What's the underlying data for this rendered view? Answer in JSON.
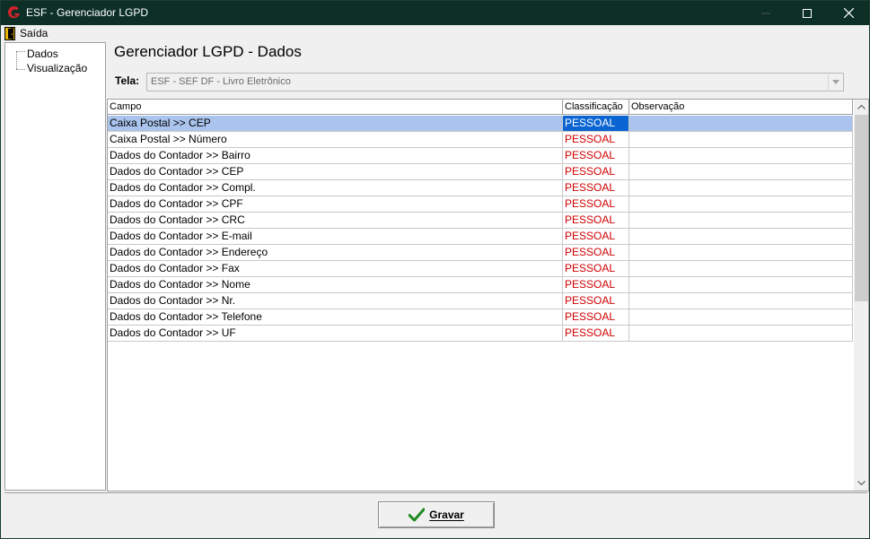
{
  "window": {
    "title": "ESF - Gerenciador LGPD",
    "title_bar_color": "#0c2f26",
    "logo_color": "#d4232b"
  },
  "menu": {
    "items": [
      {
        "label": "Saída",
        "icon": "exit-door-icon"
      }
    ]
  },
  "tree": {
    "items": [
      {
        "label": "Dados"
      },
      {
        "label": "Visualização"
      }
    ]
  },
  "main": {
    "title": "Gerenciador LGPD - Dados",
    "tela_label": "Tela:",
    "tela_value": "ESF - SEF DF - Livro Eletrônico"
  },
  "grid": {
    "columns": [
      "Campo",
      "Classificação",
      "Observação"
    ],
    "selected_row": 0,
    "classification_color": "#d00000",
    "selection_color": "#aac4ee",
    "rows": [
      {
        "campo": "Caixa Postal >> CEP",
        "classificacao": "PESSOAL",
        "observacao": ""
      },
      {
        "campo": "Caixa Postal >> Número",
        "classificacao": "PESSOAL",
        "observacao": ""
      },
      {
        "campo": "Dados do Contador >> Bairro",
        "classificacao": "PESSOAL",
        "observacao": ""
      },
      {
        "campo": "Dados do Contador >> CEP",
        "classificacao": "PESSOAL",
        "observacao": ""
      },
      {
        "campo": "Dados do Contador >> Compl.",
        "classificacao": "PESSOAL",
        "observacao": ""
      },
      {
        "campo": "Dados do Contador >> CPF",
        "classificacao": "PESSOAL",
        "observacao": ""
      },
      {
        "campo": "Dados do Contador >> CRC",
        "classificacao": "PESSOAL",
        "observacao": ""
      },
      {
        "campo": "Dados do Contador >> E-mail",
        "classificacao": "PESSOAL",
        "observacao": ""
      },
      {
        "campo": "Dados do Contador >> Endereço",
        "classificacao": "PESSOAL",
        "observacao": ""
      },
      {
        "campo": "Dados do Contador >> Fax",
        "classificacao": "PESSOAL",
        "observacao": ""
      },
      {
        "campo": "Dados do Contador >> Nome",
        "classificacao": "PESSOAL",
        "observacao": ""
      },
      {
        "campo": "Dados do Contador >> Nr.",
        "classificacao": "PESSOAL",
        "observacao": ""
      },
      {
        "campo": "Dados do Contador >> Telefone",
        "classificacao": "PESSOAL",
        "observacao": ""
      },
      {
        "campo": "Dados do Contador >> UF",
        "classificacao": "PESSOAL",
        "observacao": ""
      }
    ]
  },
  "footer": {
    "gravar_label": "Gravar",
    "gravar_icon": "checkmark-icon",
    "check_color": "#1f8a1f"
  }
}
